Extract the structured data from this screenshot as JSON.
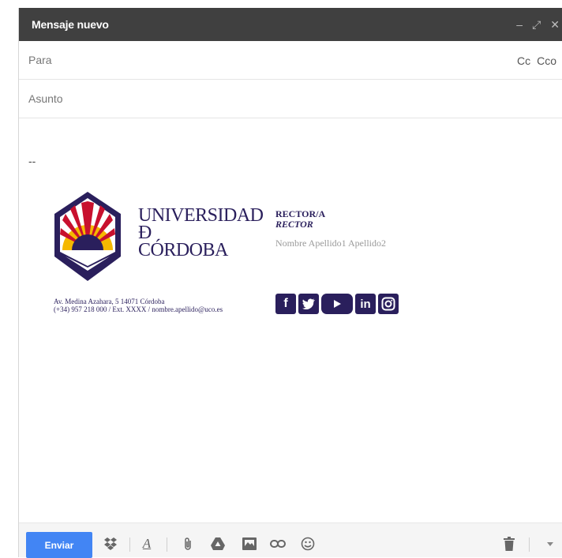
{
  "window": {
    "title": "Mensaje nuevo",
    "controls": {
      "minimize": "–",
      "expand": "⤢",
      "close": "✕"
    }
  },
  "fields": {
    "to_placeholder": "Para",
    "cc_label": "Cc",
    "bcc_label": "Cco",
    "subject_placeholder": "Asunto"
  },
  "body": {
    "signature_separator": "--",
    "signature": {
      "university_line1": "UNIVERSIDAD",
      "university_line2": "Ð",
      "university_line3": "CÓRDOBA",
      "role_es": "RECTOR/A",
      "role_en": "RECTOR",
      "person_name": "Nombre Apellido1 Apellido2",
      "address_line1": "Av. Medina Azahara, 5 14071 Córdoba",
      "address_line2": "(+34) 957 218 000 / Ext. XXXX  / nombre.apellido@uco.es",
      "social": [
        "facebook-icon",
        "twitter-icon",
        "youtube-icon",
        "linkedin-icon",
        "instagram-icon"
      ],
      "brand_color": "#2a1f5c"
    }
  },
  "toolbar": {
    "send_label": "Enviar",
    "icons": [
      "dropbox-icon",
      "text-format-icon",
      "attach-icon",
      "drive-icon",
      "photo-icon",
      "link-icon",
      "emoji-icon",
      "trash-icon",
      "more-options-icon"
    ],
    "accent": "#4285f4"
  }
}
